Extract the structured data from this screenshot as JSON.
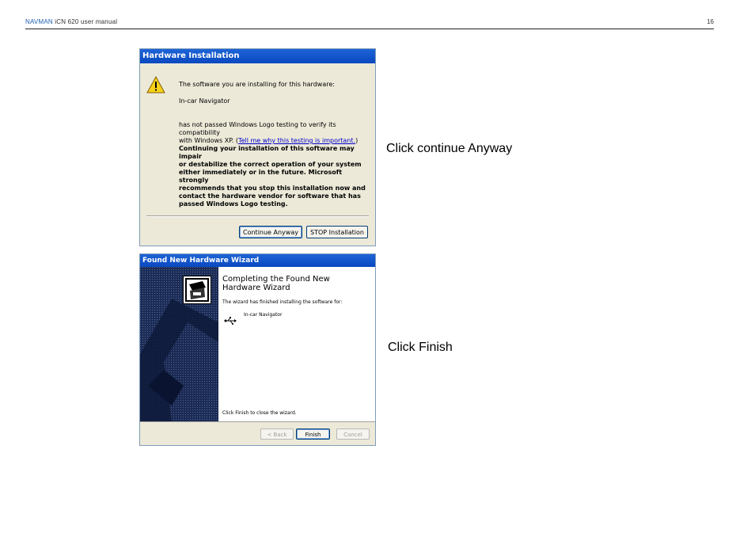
{
  "header": {
    "brand": "NAVMAN",
    "manual_title": "iCN 620 user manual",
    "page_number": "16"
  },
  "dialog1": {
    "title": "Hardware Installation",
    "icon": "warning-triangle-icon",
    "line1": "The software you are installing for this hardware:",
    "device": "In-car Navigator",
    "line2a": "has not passed Windows Logo testing to verify its compatibility",
    "line2b": "with Windows XP. (",
    "link": "Tell me why this testing is important.",
    "line2c": ")",
    "warning_text": [
      "Continuing your installation of this software may impair",
      "or destabilize the correct operation of your system",
      "either immediately or in the future. Microsoft strongly",
      "recommends that you stop this installation now and",
      "contact the hardware vendor for software that has",
      "passed Windows Logo testing."
    ],
    "continue_button": "Continue Anyway",
    "stop_button": "STOP Installation"
  },
  "dialog2": {
    "title": "Found New Hardware Wizard",
    "heading": "Completing the Found New Hardware Wizard",
    "finished_text": "The wizard has finished installing the software for:",
    "device": "In-car Navigator",
    "device_icon": "usb-icon",
    "click_finish_text": "Click Finish to close the wizard.",
    "back_button": "< Back",
    "finish_button": "Finish",
    "cancel_button": "Cancel"
  },
  "callouts": {
    "continue": "Click continue Anyway",
    "finish": "Click Finish"
  }
}
